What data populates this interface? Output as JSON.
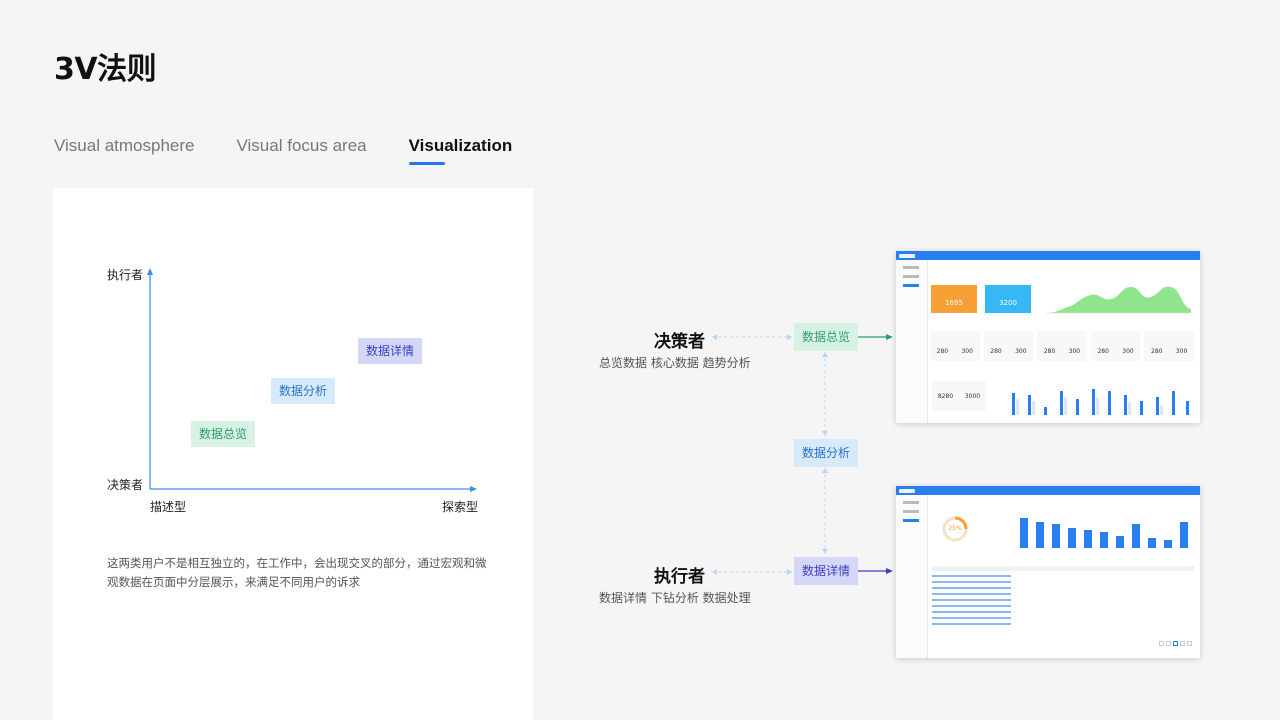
{
  "page": {
    "title": "3V法则"
  },
  "tabs": [
    {
      "label": "Visual atmosphere",
      "active": false
    },
    {
      "label": "Visual focus area",
      "active": false
    },
    {
      "label": "Visualization",
      "active": true
    }
  ],
  "diagram": {
    "y_top_label": "执行者",
    "y_bottom_label": "决策者",
    "x_left_label": "描述型",
    "x_right_label": "探索型",
    "tags": {
      "overview": "数据总览",
      "analysis": "数据分析",
      "detail": "数据详情"
    },
    "description": "这两类用户不是相互独立的，在工作中，会出现交叉的部分，通过宏观和微观数据在页面中分层展示，来满足不同用户的诉求"
  },
  "flow": {
    "decision_role": "决策者",
    "decision_tasks": "总览数据  核心数据  趋势分析",
    "executor_role": "执行者",
    "executor_tasks": "数据详情  下钻分析  数据处理",
    "node_overview": "数据总览",
    "node_analysis": "数据分析",
    "node_detail": "数据详情"
  },
  "screenshot_top": {
    "kpi": [
      "1695",
      "3200"
    ],
    "stats": [
      "280",
      "300",
      "280",
      "300",
      "280",
      "300",
      "280",
      "300",
      "280",
      "300"
    ],
    "left_stats": [
      "8280",
      "3000"
    ]
  },
  "screenshot_bottom": {
    "gauge": "25%"
  },
  "colors": {
    "accent": "#2a7ff0",
    "orange": "#f7a035",
    "cyan": "#36b8f5",
    "green": "#2e9e6b"
  }
}
